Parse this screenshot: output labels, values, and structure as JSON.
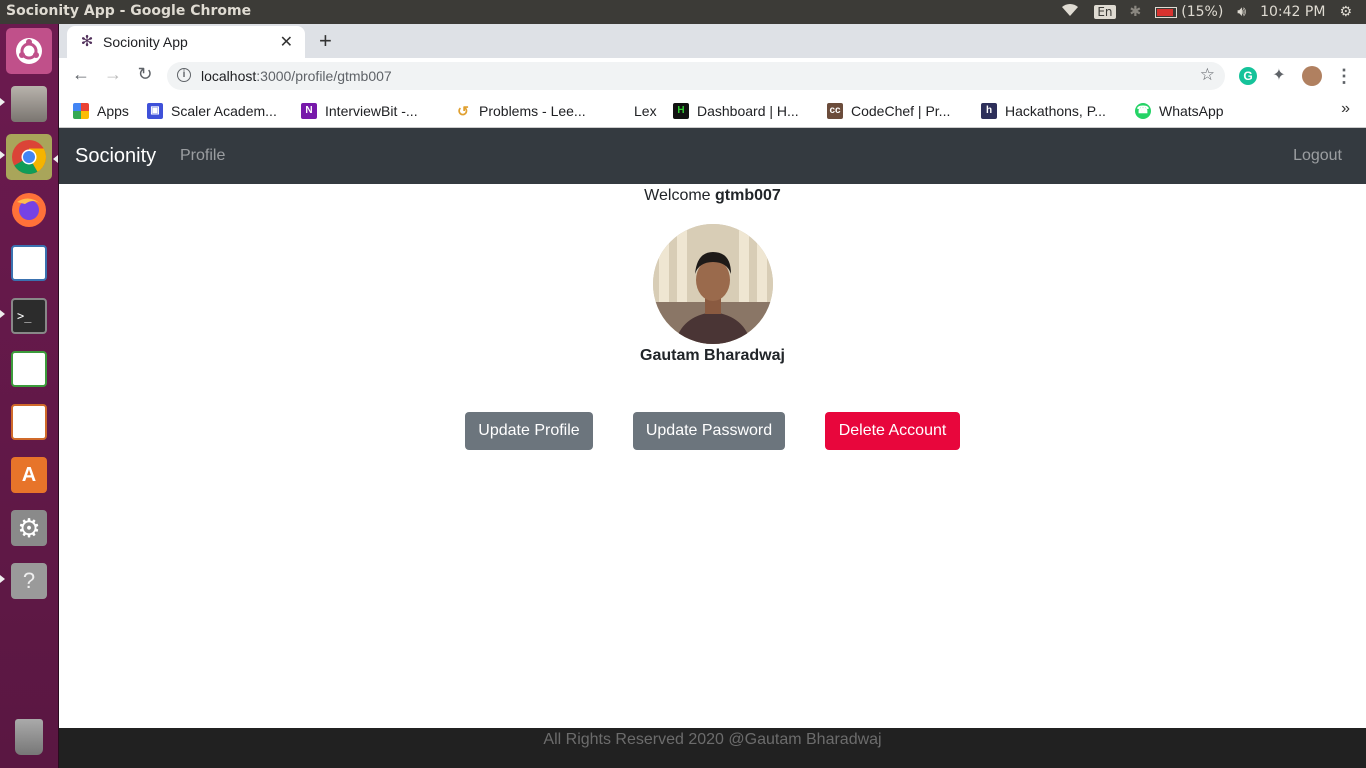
{
  "os": {
    "window_title": "Socionity App - Google Chrome",
    "keyboard_layout": "En",
    "battery": "(15%)",
    "clock": "10:42 PM"
  },
  "browser": {
    "tab_title": "Socionity App",
    "new_tab_symbol": "+",
    "url_host": "localhost",
    "url_path": ":3000/profile/gtmb007",
    "bookmarks": [
      {
        "label": "Apps"
      },
      {
        "label": "Scaler Academ..."
      },
      {
        "label": "InterviewBit -..."
      },
      {
        "label": "Problems - Lee..."
      },
      {
        "label": "Lex"
      },
      {
        "label": "Dashboard | H..."
      },
      {
        "label": "CodeChef | Pr..."
      },
      {
        "label": "Hackathons, P..."
      },
      {
        "label": "WhatsApp"
      }
    ],
    "bookmarks_more": "»"
  },
  "app": {
    "brand": "Socionity",
    "nav_profile": "Profile",
    "nav_logout": "Logout",
    "welcome_prefix": "Welcome",
    "username": "gtmb007",
    "full_name": "Gautam Bharadwaj",
    "buttons": {
      "update_profile": "Update Profile",
      "update_password": "Update Password",
      "delete_account": "Delete Account"
    },
    "footer": "All Rights Reserved 2020 @Gautam Bharadwaj"
  },
  "colors": {
    "navbar": "#343a40",
    "btn_secondary": "#6c757d",
    "btn_danger": "#e8063c",
    "footer": "#212121",
    "launcher": "#6b1a4f"
  }
}
